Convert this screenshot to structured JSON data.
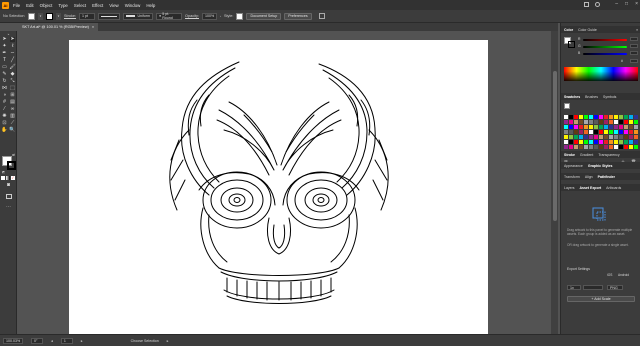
{
  "app": {
    "logo": "Ai"
  },
  "menu": [
    "File",
    "Edit",
    "Object",
    "Type",
    "Select",
    "Effect",
    "View",
    "Window",
    "Help"
  ],
  "control_bar": {
    "selection": "No Selection",
    "stroke_label": "Stroke:",
    "stroke_value": "1 pt",
    "brush": "Uniform",
    "brush_round": "5 pt. Round",
    "opacity_label": "Opacity:",
    "opacity_value": "100%",
    "style_label": "Style:",
    "document_setup": "Document Setup",
    "preferences": "Preferences"
  },
  "document_tab": {
    "title": "SKT Art.ai* @ 100.01 % (RGB/Preview)",
    "close": "×"
  },
  "status": {
    "zoom": "100.03%",
    "angle": "0°",
    "artboard": "1",
    "tool": "Choose Selection"
  },
  "panels": {
    "color": {
      "tabs": [
        "Color",
        "Color Guide"
      ],
      "channels": [
        "R",
        "G",
        "B"
      ],
      "hex": "#"
    },
    "swatches": {
      "tabs": [
        "Swatches",
        "Brushes",
        "Symbols"
      ]
    },
    "stroke": {
      "tabs": [
        "Stroke",
        "Gradient",
        "Transparency"
      ]
    },
    "appearance": {
      "tabs": [
        "Appearance",
        "Graphic Styles"
      ]
    },
    "transform": {
      "tabs": [
        "Transform",
        "Align",
        "Pathfinder"
      ]
    },
    "asset_export": {
      "tabs": [
        "Layers",
        "Asset Export",
        "Artboards"
      ],
      "help_text_1": "Drag artwork to this panel to generate multiple assets. Each group is added as an asset.",
      "help_text_2": "OR drag artwork to generate a single asset.",
      "export_settings": "Export Settings",
      "ios": "iOS",
      "android": "Android",
      "scale": "1x",
      "format": "PNG",
      "add_scale": "+ Add Scale"
    }
  },
  "colors": {
    "accent": "#ff9a00",
    "chrome": "#3c3c3c",
    "canvas": "#535353",
    "artboard": "#ffffff"
  }
}
